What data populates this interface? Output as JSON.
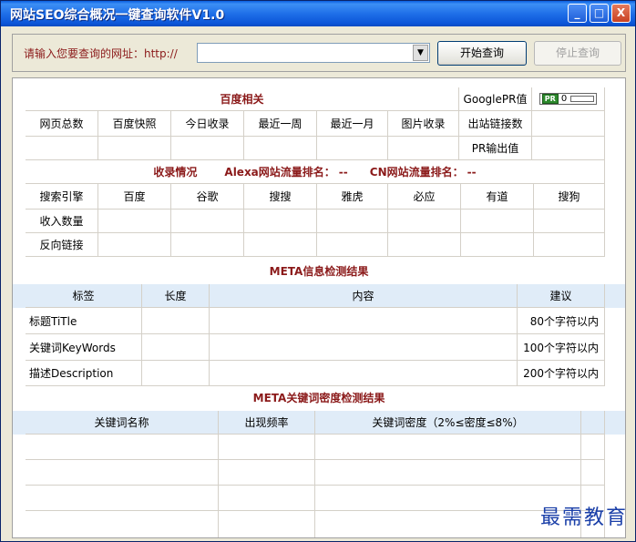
{
  "window": {
    "title": "网站SEO综合概况一键查询软件V1.0",
    "min": "_",
    "max": "□",
    "close": "X"
  },
  "topbar": {
    "url_label": "请输入您要查询的网址：http://",
    "url_value": "",
    "start_button": "开始查询",
    "stop_button": "停止查询",
    "arrow": "▼"
  },
  "baidu": {
    "section_title": "百度相关",
    "google_pr_label": "GooglePR值",
    "pr_badge": "PR",
    "pr_value": "0",
    "headers": [
      "网页总数",
      "百度快照",
      "今日收录",
      "最近一周",
      "最近一月",
      "图片收录",
      "出站链接数"
    ],
    "pr_output_label": "PR输出值"
  },
  "indexing": {
    "section_title": "收录情况",
    "alexa_label": "Alexa网站流量排名：",
    "alexa_value": "--",
    "cn_label": "CN网站流量排名：",
    "cn_value": "--",
    "engines": [
      "搜索引擎",
      "百度",
      "谷歌",
      "搜搜",
      "雅虎",
      "必应",
      "有道",
      "搜狗"
    ],
    "row_labels": [
      "收入数量",
      "反向链接"
    ]
  },
  "meta": {
    "section_title": "META信息检测结果",
    "headers": [
      "标签",
      "长度",
      "内容",
      "建议"
    ],
    "rows": [
      {
        "tag": "标题TiTle",
        "advice": "80个字符以内"
      },
      {
        "tag": "关键词KeyWords",
        "advice": "100个字符以内"
      },
      {
        "tag": "描述Description",
        "advice": "200个字符以内"
      }
    ]
  },
  "density": {
    "section_title": "META关键词密度检测结果",
    "headers": [
      "关键词名称",
      "出现频率",
      "关键词密度（2%≤密度≤8%）"
    ]
  },
  "watermark": "最需教育"
}
